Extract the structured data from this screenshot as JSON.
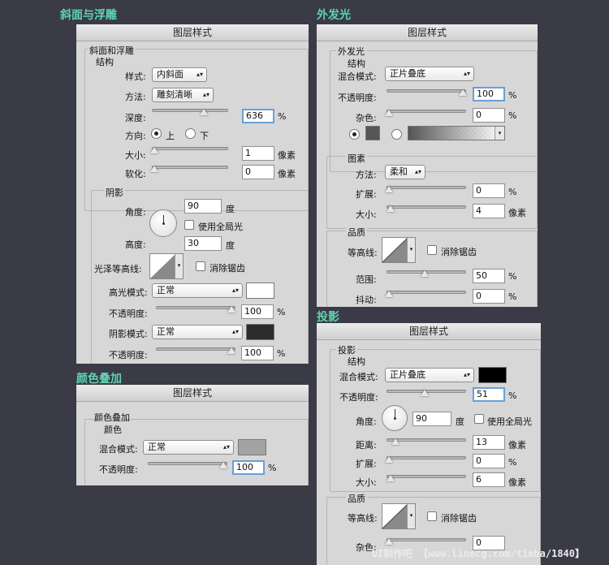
{
  "titles": {
    "bevel": "斜面与浮雕",
    "outer_glow": "外发光",
    "color_overlay": "颜色叠加",
    "drop_shadow": "投影"
  },
  "dialog_title": "图层样式",
  "bevel": {
    "group": "斜面和浮雕",
    "structure": "结构",
    "style_label": "样式:",
    "style_value": "内斜面",
    "method_label": "方法:",
    "method_value": "雕刻清晰",
    "depth_label": "深度:",
    "depth_value": "636",
    "depth_unit": "%",
    "direction_label": "方向:",
    "dir_up": "上",
    "dir_down": "下",
    "size_label": "大小:",
    "size_value": "1",
    "size_unit": "像素",
    "soften_label": "软化:",
    "soften_value": "0",
    "soften_unit": "像素",
    "shading": "阴影",
    "angle_label": "角度:",
    "angle_value": "90",
    "angle_unit": "度",
    "global_light": "使用全局光",
    "altitude_label": "高度:",
    "altitude_value": "30",
    "altitude_unit": "度",
    "gloss_label": "光泽等高线:",
    "anti_alias": "消除锯齿",
    "highlight_label": "高光模式:",
    "highlight_value": "正常",
    "opacity_label": "不透明度:",
    "highlight_opacity": "100",
    "opacity_unit": "%",
    "shadow_label": "阴影模式:",
    "shadow_value": "正常",
    "shadow_opacity": "100"
  },
  "outer_glow": {
    "group": "外发光",
    "structure": "结构",
    "blend_label": "混合模式:",
    "blend_value": "正片叠底",
    "opacity_label": "不透明度:",
    "opacity_value": "100",
    "pct": "%",
    "noise_label": "杂色:",
    "noise_value": "0",
    "elements": "图素",
    "technique_label": "方法:",
    "technique_value": "柔和",
    "spread_label": "扩展:",
    "spread_value": "0",
    "size_label": "大小:",
    "size_value": "4",
    "px": "像素",
    "quality": "品质",
    "contour_label": "等高线:",
    "anti_alias": "消除锯齿",
    "range_label": "范围:",
    "range_value": "50",
    "jitter_label": "抖动:",
    "jitter_value": "0"
  },
  "color_overlay": {
    "group": "颜色叠加",
    "color": "颜色",
    "blend_label": "混合模式:",
    "blend_value": "正常",
    "opacity_label": "不透明度:",
    "opacity_value": "100",
    "pct": "%"
  },
  "drop_shadow": {
    "group": "投影",
    "structure": "结构",
    "blend_label": "混合模式:",
    "blend_value": "正片叠底",
    "opacity_label": "不透明度:",
    "opacity_value": "51",
    "pct": "%",
    "angle_label": "角度:",
    "angle_value": "90",
    "angle_unit": "度",
    "global_light": "使用全局光",
    "distance_label": "距离:",
    "distance_value": "13",
    "px": "像素",
    "spread_label": "扩展:",
    "spread_value": "0",
    "size_label": "大小:",
    "size_value": "6",
    "quality": "品质",
    "contour_label": "等高线:",
    "anti_alias": "消除锯齿",
    "noise_label": "杂色:",
    "noise_value": "0"
  },
  "watermark": "UI制作吧 【www.linecg.com/tieba/1840】",
  "colors": {
    "background": "#3a3b47",
    "title_green": "#5ed3b0",
    "highlight_swatch": "#ffffff",
    "shadow_swatch": "#2b2b2b",
    "glow_swatch": "#555555",
    "overlay_swatch": "#a3a3a3",
    "drop_shadow_swatch": "#000000",
    "focus_blue": "#6a9fd8"
  }
}
